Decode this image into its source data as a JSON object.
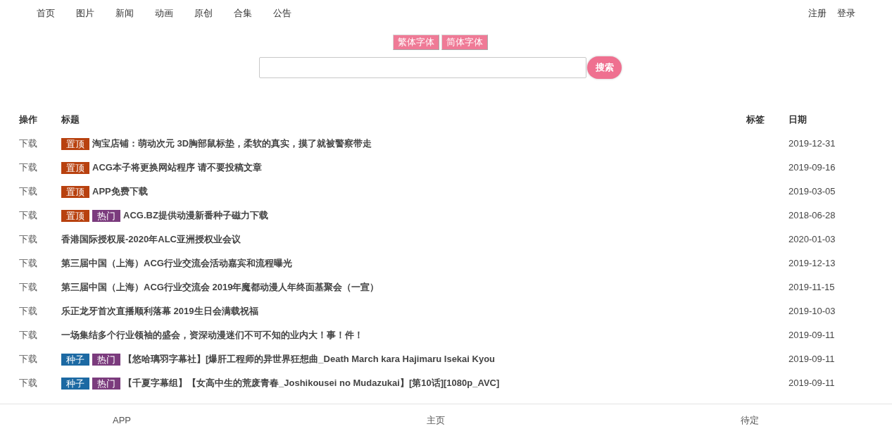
{
  "nav": {
    "links": [
      "首页",
      "图片",
      "新闻",
      "动画",
      "原创",
      "合集",
      "公告"
    ],
    "account_links": [
      "注册",
      "登录"
    ]
  },
  "font_switch": [
    "繁体字体",
    "简体字体"
  ],
  "search": {
    "button": "搜索"
  },
  "table": {
    "columns": [
      "操作",
      "标题",
      "标签",
      "日期"
    ],
    "rows": [
      {
        "action": "下载",
        "badges": [
          {
            "label": "置顶",
            "color": "#b8410f"
          }
        ],
        "title": "淘宝店铺：萌动次元 3D胸部鼠标垫，柔软的真实，摸了就被警察带走",
        "date": "2019-12-31"
      },
      {
        "action": "下载",
        "badges": [
          {
            "label": "置顶",
            "color": "#b8410f"
          }
        ],
        "title": "ACG本子将更换网站程序 请不要投稿文章",
        "date": "2019-09-16"
      },
      {
        "action": "下载",
        "badges": [
          {
            "label": "置顶",
            "color": "#b8410f"
          }
        ],
        "title": "APP免费下载",
        "date": "2019-03-05"
      },
      {
        "action": "下载",
        "badges": [
          {
            "label": "置顶",
            "color": "#b8410f"
          },
          {
            "label": "热门",
            "color": "#7b3b7d"
          }
        ],
        "title": "ACG.BZ提供动漫新番种子磁力下载",
        "date": "2018-06-28"
      },
      {
        "action": "下载",
        "badges": [],
        "title": "香港国际授权展-2020年ALC亚洲授权业会议",
        "date": "2020-01-03"
      },
      {
        "action": "下载",
        "badges": [],
        "title": "第三届中国（上海）ACG行业交流会活动嘉宾和流程曝光",
        "date": "2019-12-13"
      },
      {
        "action": "下载",
        "badges": [],
        "title": "第三届中国（上海）ACG行业交流会 2019年魔都动漫人年终面基聚会（一宣）",
        "date": "2019-11-15"
      },
      {
        "action": "下载",
        "badges": [],
        "title": "乐正龙牙首次直播顺利落幕 2019生日会满载祝福",
        "date": "2019-10-03"
      },
      {
        "action": "下载",
        "badges": [],
        "title": "一场集结多个行业领袖的盛会，资深动漫迷们不可不知的业内大！事！件！",
        "date": "2019-09-11"
      },
      {
        "action": "下载",
        "badges": [
          {
            "label": "种子",
            "color": "#1c69a3"
          },
          {
            "label": "热门",
            "color": "#7b3b7d"
          }
        ],
        "title": "【悠哈璃羽字幕社】[爆肝工程师的异世界狂想曲_Death March kara Hajimaru Isekai Kyou",
        "date": "2019-09-11"
      },
      {
        "action": "下载",
        "badges": [
          {
            "label": "种子",
            "color": "#1c69a3"
          },
          {
            "label": "热门",
            "color": "#7b3b7d"
          }
        ],
        "title": "【千夏字幕组】【女高中生的荒废青春_Joshikousei no Mudazukai】[第10话][1080p_AVC]",
        "date": "2019-09-11"
      }
    ]
  },
  "footer": {
    "links": [
      "APP",
      "主页",
      "待定"
    ]
  }
}
